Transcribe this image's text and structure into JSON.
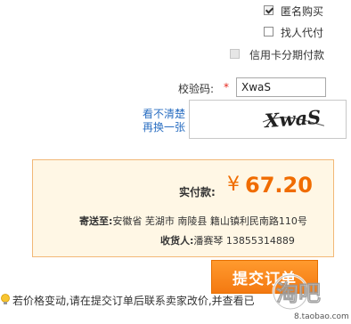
{
  "options": {
    "anonymous_label": "匿名购买",
    "proxy_label": "找人代付",
    "installment_label": "信用卡分期付款"
  },
  "captcha": {
    "label": "校验码:",
    "required_mark": "*",
    "value": "XwaS",
    "image_text": "XwaS",
    "refresh_line1": "看不清楚",
    "refresh_line2": "再换一张"
  },
  "summary": {
    "amount_label": "实付款:",
    "currency": "¥",
    "amount": "67.20",
    "address_label": "寄送至:",
    "address": "安徽省 芜湖市 南陵县 籍山镇利民南路110号",
    "receiver_label": "收货人:",
    "receiver": "潘赛琴 13855314889"
  },
  "submit_label": "提交订单",
  "tip_text": "若价格变动,请在提交订单后联系卖家改价,并查看已",
  "watermark": {
    "text": "淘吧",
    "url": "8.taobao.com"
  },
  "colors": {
    "accent_orange": "#f47911",
    "price_orange": "#f06c00",
    "summary_border": "#f2b877",
    "summary_bg": "#fff7e5",
    "link_blue": "#2b6fc2"
  }
}
